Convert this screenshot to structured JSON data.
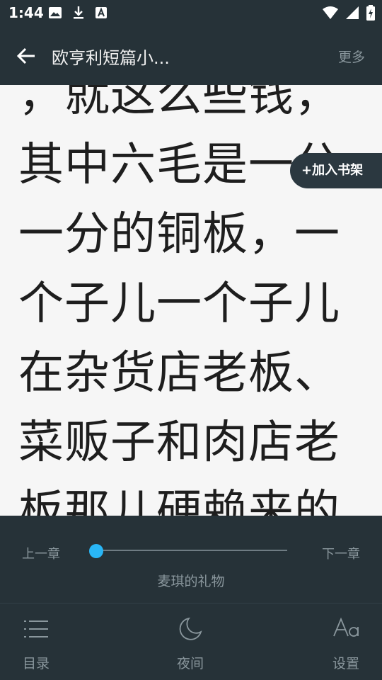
{
  "status_bar": {
    "time": "1:44"
  },
  "app_bar": {
    "title": "欧亨利短篇小...",
    "more_label": "更多"
  },
  "reader": {
    "text": "，就这么些钱，其中六毛是一分一分的铜板，一个子儿一个子儿在杂货店老板、菜贩子和肉店老板那儿硬赖来的",
    "add_to_shelf_label": "+加入书架"
  },
  "panel": {
    "prev_chapter_label": "上一章",
    "next_chapter_label": "下一章",
    "chapter_progress": 0,
    "chapter_title": "麦琪的礼物",
    "tabs": {
      "toc": "目录",
      "night": "夜间",
      "settings": "设置"
    }
  },
  "colors": {
    "bar_background": "#263238",
    "accent": "#29b6f6",
    "muted_text": "#8a979d",
    "page_background": "#f6f6f6"
  }
}
